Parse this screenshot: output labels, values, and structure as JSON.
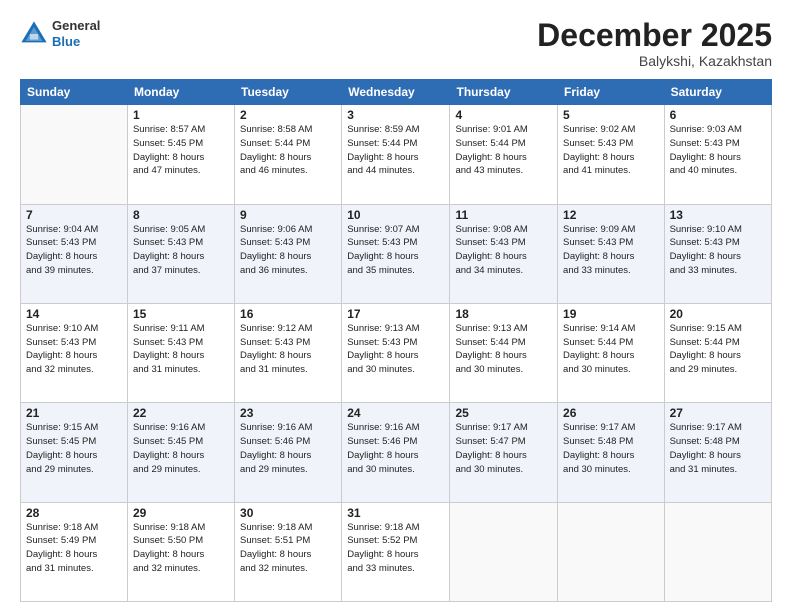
{
  "header": {
    "logo_general": "General",
    "logo_blue": "Blue",
    "month_year": "December 2025",
    "location": "Balykshi, Kazakhstan"
  },
  "days_of_week": [
    "Sunday",
    "Monday",
    "Tuesday",
    "Wednesday",
    "Thursday",
    "Friday",
    "Saturday"
  ],
  "weeks": [
    [
      {
        "day": "",
        "info": ""
      },
      {
        "day": "1",
        "info": "Sunrise: 8:57 AM\nSunset: 5:45 PM\nDaylight: 8 hours\nand 47 minutes."
      },
      {
        "day": "2",
        "info": "Sunrise: 8:58 AM\nSunset: 5:44 PM\nDaylight: 8 hours\nand 46 minutes."
      },
      {
        "day": "3",
        "info": "Sunrise: 8:59 AM\nSunset: 5:44 PM\nDaylight: 8 hours\nand 44 minutes."
      },
      {
        "day": "4",
        "info": "Sunrise: 9:01 AM\nSunset: 5:44 PM\nDaylight: 8 hours\nand 43 minutes."
      },
      {
        "day": "5",
        "info": "Sunrise: 9:02 AM\nSunset: 5:43 PM\nDaylight: 8 hours\nand 41 minutes."
      },
      {
        "day": "6",
        "info": "Sunrise: 9:03 AM\nSunset: 5:43 PM\nDaylight: 8 hours\nand 40 minutes."
      }
    ],
    [
      {
        "day": "7",
        "info": "Sunrise: 9:04 AM\nSunset: 5:43 PM\nDaylight: 8 hours\nand 39 minutes."
      },
      {
        "day": "8",
        "info": "Sunrise: 9:05 AM\nSunset: 5:43 PM\nDaylight: 8 hours\nand 37 minutes."
      },
      {
        "day": "9",
        "info": "Sunrise: 9:06 AM\nSunset: 5:43 PM\nDaylight: 8 hours\nand 36 minutes."
      },
      {
        "day": "10",
        "info": "Sunrise: 9:07 AM\nSunset: 5:43 PM\nDaylight: 8 hours\nand 35 minutes."
      },
      {
        "day": "11",
        "info": "Sunrise: 9:08 AM\nSunset: 5:43 PM\nDaylight: 8 hours\nand 34 minutes."
      },
      {
        "day": "12",
        "info": "Sunrise: 9:09 AM\nSunset: 5:43 PM\nDaylight: 8 hours\nand 33 minutes."
      },
      {
        "day": "13",
        "info": "Sunrise: 9:10 AM\nSunset: 5:43 PM\nDaylight: 8 hours\nand 33 minutes."
      }
    ],
    [
      {
        "day": "14",
        "info": "Sunrise: 9:10 AM\nSunset: 5:43 PM\nDaylight: 8 hours\nand 32 minutes."
      },
      {
        "day": "15",
        "info": "Sunrise: 9:11 AM\nSunset: 5:43 PM\nDaylight: 8 hours\nand 31 minutes."
      },
      {
        "day": "16",
        "info": "Sunrise: 9:12 AM\nSunset: 5:43 PM\nDaylight: 8 hours\nand 31 minutes."
      },
      {
        "day": "17",
        "info": "Sunrise: 9:13 AM\nSunset: 5:43 PM\nDaylight: 8 hours\nand 30 minutes."
      },
      {
        "day": "18",
        "info": "Sunrise: 9:13 AM\nSunset: 5:44 PM\nDaylight: 8 hours\nand 30 minutes."
      },
      {
        "day": "19",
        "info": "Sunrise: 9:14 AM\nSunset: 5:44 PM\nDaylight: 8 hours\nand 30 minutes."
      },
      {
        "day": "20",
        "info": "Sunrise: 9:15 AM\nSunset: 5:44 PM\nDaylight: 8 hours\nand 29 minutes."
      }
    ],
    [
      {
        "day": "21",
        "info": "Sunrise: 9:15 AM\nSunset: 5:45 PM\nDaylight: 8 hours\nand 29 minutes."
      },
      {
        "day": "22",
        "info": "Sunrise: 9:16 AM\nSunset: 5:45 PM\nDaylight: 8 hours\nand 29 minutes."
      },
      {
        "day": "23",
        "info": "Sunrise: 9:16 AM\nSunset: 5:46 PM\nDaylight: 8 hours\nand 29 minutes."
      },
      {
        "day": "24",
        "info": "Sunrise: 9:16 AM\nSunset: 5:46 PM\nDaylight: 8 hours\nand 30 minutes."
      },
      {
        "day": "25",
        "info": "Sunrise: 9:17 AM\nSunset: 5:47 PM\nDaylight: 8 hours\nand 30 minutes."
      },
      {
        "day": "26",
        "info": "Sunrise: 9:17 AM\nSunset: 5:48 PM\nDaylight: 8 hours\nand 30 minutes."
      },
      {
        "day": "27",
        "info": "Sunrise: 9:17 AM\nSunset: 5:48 PM\nDaylight: 8 hours\nand 31 minutes."
      }
    ],
    [
      {
        "day": "28",
        "info": "Sunrise: 9:18 AM\nSunset: 5:49 PM\nDaylight: 8 hours\nand 31 minutes."
      },
      {
        "day": "29",
        "info": "Sunrise: 9:18 AM\nSunset: 5:50 PM\nDaylight: 8 hours\nand 32 minutes."
      },
      {
        "day": "30",
        "info": "Sunrise: 9:18 AM\nSunset: 5:51 PM\nDaylight: 8 hours\nand 32 minutes."
      },
      {
        "day": "31",
        "info": "Sunrise: 9:18 AM\nSunset: 5:52 PM\nDaylight: 8 hours\nand 33 minutes."
      },
      {
        "day": "",
        "info": ""
      },
      {
        "day": "",
        "info": ""
      },
      {
        "day": "",
        "info": ""
      }
    ]
  ]
}
